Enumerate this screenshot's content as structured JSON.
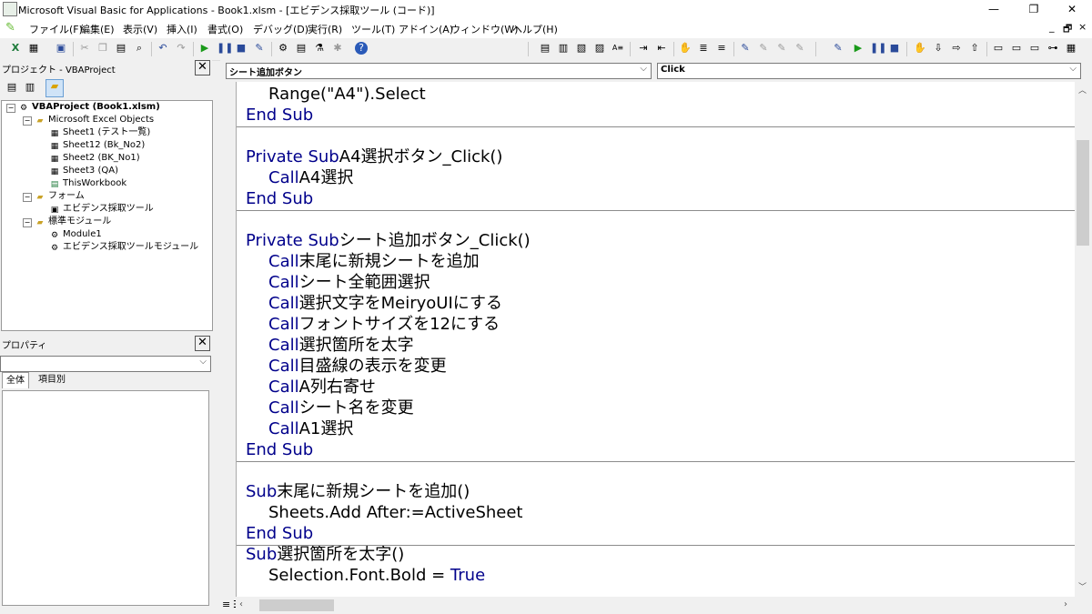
{
  "title": "Microsoft Visual Basic for Applications - Book1.xlsm - [エビデンス採取ツール (コード)]",
  "window_buttons": [
    "—",
    "❐",
    "✕"
  ],
  "menu": [
    "ファイル(F)",
    "編集(E)",
    "表示(V)",
    "挿入(I)",
    "書式(O)",
    "デバッグ(D)",
    "実行(R)",
    "ツール(T)",
    "アドイン(A)",
    "ウィンドウ(W)",
    "ヘルプ(H)"
  ],
  "mdi_buttons": [
    "_",
    "🗗",
    "×"
  ],
  "project": {
    "header": "プロジェクト - VBAProject",
    "close": "✕",
    "root": "VBAProject (Book1.xlsm)",
    "excel_objects": "Microsoft Excel Objects",
    "sheets": [
      "Sheet1 (テスト一覧)",
      "Sheet12 (Bk_No2)",
      "Sheet2 (BK_No1)",
      "Sheet3 (QA)",
      "ThisWorkbook"
    ],
    "forms_folder": "フォーム",
    "forms": [
      "エビデンス採取ツール"
    ],
    "modules_folder": "標準モジュール",
    "modules": [
      "Module1",
      "エビデンス採取ツールモジュール"
    ]
  },
  "properties": {
    "header": "プロパティ",
    "close": "✕",
    "tab_all": "全体",
    "tab_category": "項目別"
  },
  "code": {
    "object_combo": "シート追加ボタン",
    "proc_combo": "Click",
    "lines": [
      {
        "kw": "",
        "text": "    Range(\"A4\").Select"
      },
      {
        "kw": "End Sub",
        "text": ""
      },
      {
        "kw": "",
        "text": ""
      },
      {
        "kw": "Private Sub",
        "text": " A4選択ボタン_Click()"
      },
      {
        "kw": "    Call",
        "text": " A4選択"
      },
      {
        "kw": "End Sub",
        "text": ""
      },
      {
        "kw": "",
        "text": ""
      },
      {
        "kw": "Private Sub",
        "text": " シート追加ボタン_Click()"
      },
      {
        "kw": "    Call",
        "text": " 末尾に新規シートを追加"
      },
      {
        "kw": "    Call",
        "text": " シート全範囲選択"
      },
      {
        "kw": "    Call",
        "text": " 選択文字をMeiryoUIにする"
      },
      {
        "kw": "    Call",
        "text": " フォントサイズを12にする"
      },
      {
        "kw": "    Call",
        "text": " 選択箇所を太字"
      },
      {
        "kw": "    Call",
        "text": " 目盛線の表示を変更"
      },
      {
        "kw": "    Call",
        "text": " A列右寄せ"
      },
      {
        "kw": "    Call",
        "text": " シート名を変更"
      },
      {
        "kw": "    Call",
        "text": " A1選択"
      },
      {
        "kw": "End Sub",
        "text": ""
      },
      {
        "kw": "",
        "text": ""
      },
      {
        "kw": "Sub",
        "text": " 末尾に新規シートを追加()"
      },
      {
        "kw": "",
        "text": "    Sheets.Add After:=ActiveSheet"
      },
      {
        "kw": "End Sub",
        "text": ""
      },
      {
        "kw": "Sub",
        "text": " 選択箇所を太字()"
      },
      {
        "kw": "",
        "text": "    Selection.Font.Bold = ",
        "tail": "True"
      }
    ],
    "separators_after": [
      1,
      5,
      17,
      21
    ]
  }
}
